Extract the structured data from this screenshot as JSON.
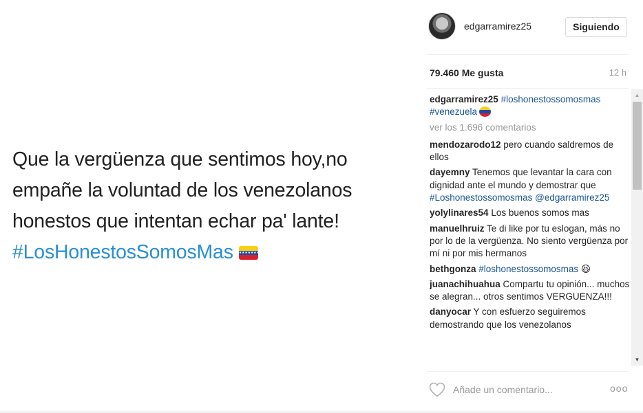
{
  "post": {
    "text_line1": "Que la vergüenza que sentimos hoy,no",
    "text_line2": "empañe la voluntad de los venezolanos",
    "text_line3": "honestos que intentan echar pa' lante!",
    "hashtag": "#LosHonestosSomosMas",
    "flag_icon": "venezuela-flag-icon"
  },
  "header": {
    "username": "edgarramirez25",
    "follow_label": "Siguiendo"
  },
  "stats": {
    "likes": "79.460 Me gusta",
    "time": "12 h"
  },
  "caption": {
    "user": "edgarramirez25",
    "tag1": "#loshonestossomosmas",
    "tag2": "#venezuela"
  },
  "view_all": "ver los 1.696 comentarios",
  "comments": [
    {
      "user": "mendozarodo12",
      "text": "pero cuando saldremos de ellos"
    },
    {
      "user": "dayemny",
      "text": "Tenemos que levantar la cara con dignidad ante el mundo y demostrar que ",
      "tag": "#Loshonestossomosmas",
      "tag2": "@edgarramirez25"
    },
    {
      "user": "yolylinares54",
      "text": "Los buenos somos mas"
    },
    {
      "user": "manuelhruiz",
      "text": "Te di like por tu eslogan, más no por lo de la vergüenza. No siento vergüenza por mí ni por mis hermanos"
    },
    {
      "user": "bethgonza",
      "tag": "#loshonestossomosmas",
      "emoji": "😆"
    },
    {
      "user": "juanachihuahua",
      "text": "Compartu tu opinión... muchos se alegran... otros sentimos VERGUENZA!!!"
    },
    {
      "user": "danyocar",
      "text": "Y con esfuerzo seguiremos demostrando que los venezolanos"
    }
  ],
  "footer": {
    "placeholder": "Añade un comentario...",
    "more": "ooo"
  },
  "colors": {
    "link": "#1a5596",
    "post_hashtag": "#2a8fd1",
    "muted": "#999999"
  }
}
